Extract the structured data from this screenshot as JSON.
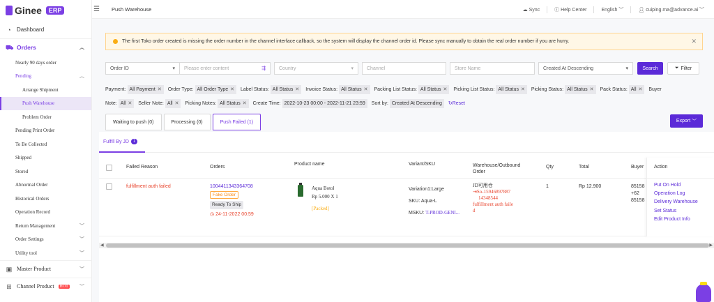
{
  "brand": {
    "name": "Ginee",
    "badge": "ERP"
  },
  "sidebar": {
    "dashboard": "Dashboard",
    "orders": "Orders",
    "items": [
      {
        "label": "Nearly 90 days order"
      },
      {
        "label": "Pending"
      },
      {
        "label": "Arrange Shipment"
      },
      {
        "label": "Push Warehouse"
      },
      {
        "label": "Problem Order"
      },
      {
        "label": "Pending Print Order"
      },
      {
        "label": "To Be Collected"
      },
      {
        "label": "Shipped"
      },
      {
        "label": "Stored"
      },
      {
        "label": "Abnormal Order"
      },
      {
        "label": "Historical Orders"
      },
      {
        "label": "Operation Record"
      },
      {
        "label": "Return Management"
      },
      {
        "label": "Order Settings"
      },
      {
        "label": "Utility tool"
      }
    ],
    "master_product": "Master Product",
    "channel_product": "Channel Product",
    "hot": "HOT"
  },
  "header": {
    "title": "Push Warehouse",
    "sync": "Sync",
    "help": "Help Center",
    "language": "English",
    "user": "cuiping.ma@advance.ai"
  },
  "alert": "The first Toko order created is missing the order number in the channel interface callback, so the system will display the channel order id. Please sync manually to obtain the real order number if you are hurry.",
  "filters": {
    "order_id": "Order ID",
    "search_placeholder": "Please enter content",
    "country_placeholder": "Country",
    "channel_placeholder": "Channel",
    "store_placeholder": "Store Name",
    "sort": "Created At Descending",
    "search_btn": "Search",
    "filter_btn": "Filter"
  },
  "chips": {
    "payment_label": "Payment:",
    "payment_value": "All Payment",
    "order_type_label": "Order Type:",
    "order_type_value": "All Order Type",
    "label_status_label": "Label Status:",
    "label_status_value": "All Status",
    "invoice_status_label": "Invoice Status:",
    "invoice_status_value": "All Status",
    "packing_list_label": "Packing List Status:",
    "packing_list_value": "All Status",
    "picking_list_label": "Picking List Status:",
    "picking_list_value": "All Status",
    "picking_status_label": "Picking Status:",
    "picking_status_value": "All Status",
    "pack_status_label": "Pack Status:",
    "pack_status_value": "All",
    "buyer_note_label_1": "Buyer",
    "buyer_note_label_2": "Note:",
    "buyer_note_value": "All",
    "seller_note_label": "Seller Note:",
    "seller_note_value": "All",
    "picking_notes_label": "Picking Notes:",
    "picking_notes_value": "All Status",
    "create_time_label": "Create Time:",
    "create_time_value": "2022-10-23 00:00 - 2022-11-21 23:59",
    "sort_by_label": "Sort by:",
    "sort_by_value": "Created At Descending",
    "reset": "Reset"
  },
  "tabs": [
    {
      "label": "Waiting to push (0)"
    },
    {
      "label": "Processing (0)"
    },
    {
      "label": "Push Failed (1)"
    }
  ],
  "export": "Export",
  "subtab": {
    "label": "Fulfill By JD",
    "count": "1"
  },
  "table": {
    "headers": {
      "failed_reason": "Failed Reason",
      "orders": "Orders",
      "product": "Product name",
      "variant": "Variant/SKU",
      "warehouse_1": "Warehouse/Outbound",
      "warehouse_2": "Order",
      "qty": "Qty",
      "total": "Total",
      "buyer": "Buyer",
      "action": "Action"
    },
    "row": {
      "failed_reason": "fulfillment auth failed",
      "order_id": "1004411343364708",
      "fake_tag": "Fake Order",
      "status_tag": "Ready To Ship",
      "time": "24-11-2022 00:59",
      "product_name": "Aqua Botol",
      "price": "Rp 5.000 X 1",
      "packed": "[Packed]",
      "variation": "Variation1:Large",
      "sku": "SKU:  Aqua-L",
      "msku_label": "MSKU:",
      "msku_value": "T-PROD-GENI...",
      "warehouse": "JD可用仓",
      "outbound_1": "So-15946897887",
      "outbound_2": "14348544",
      "wh_error_1": "fulfillment auth faile",
      "wh_error_2": "d",
      "qty": "1",
      "total": "Rp 12.900",
      "buyer_1": "85158",
      "buyer_2": "+62",
      "buyer_3": "85158"
    },
    "actions": [
      "Put On Hold",
      "Operation Log",
      "Delivery Warehouse",
      "Set Status",
      "Edit Product Info"
    ]
  }
}
